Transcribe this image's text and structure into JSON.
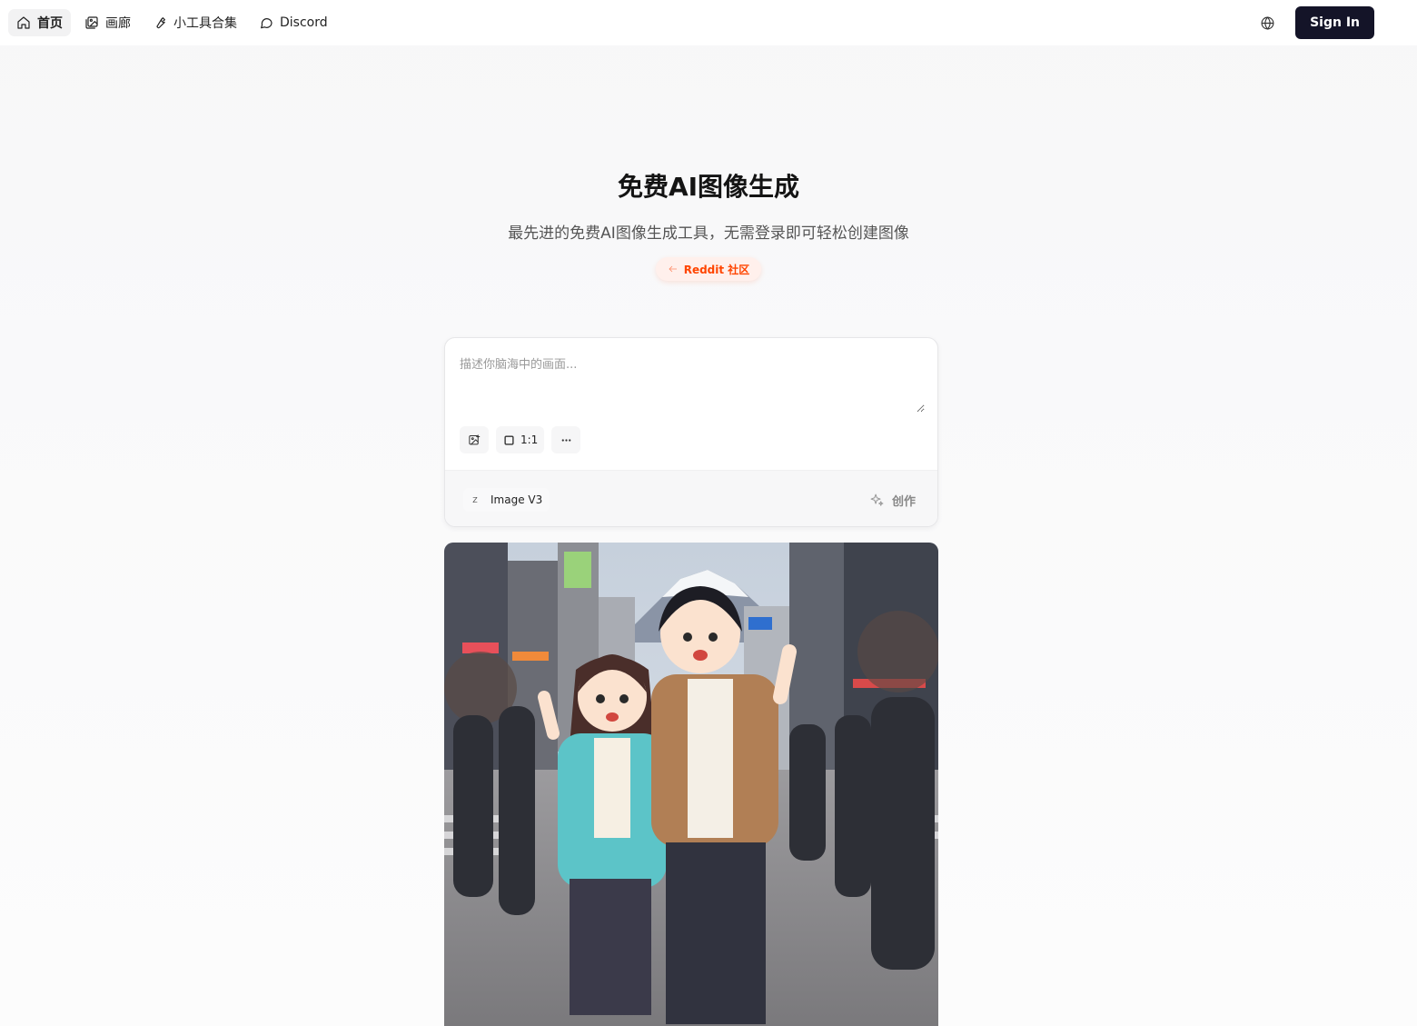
{
  "nav": {
    "items": [
      {
        "label": "首页",
        "icon": "home-icon",
        "active": true
      },
      {
        "label": "画廊",
        "icon": "gallery-icon",
        "active": false
      },
      {
        "label": "小工具合集",
        "icon": "wrench-icon",
        "active": false
      },
      {
        "label": "Discord",
        "icon": "chat-bubble-icon",
        "active": false
      }
    ],
    "signin_label": "Sign In"
  },
  "hero": {
    "title": "免费AI图像生成",
    "subtitle": "最先进的免费AI图像生成工具，无需登录即可轻松创建图像",
    "badge_label": "Reddit 社区"
  },
  "prompt_card": {
    "placeholder": "描述你脑海中的画面...",
    "aspect_ratio": "1:1",
    "model_name": "Image V3",
    "model_logo_letter": "Z",
    "create_label": "创作"
  },
  "colors": {
    "signin_bg": "#141428",
    "badge_text": "#ff4500",
    "badge_bg": "#fff0ec"
  }
}
